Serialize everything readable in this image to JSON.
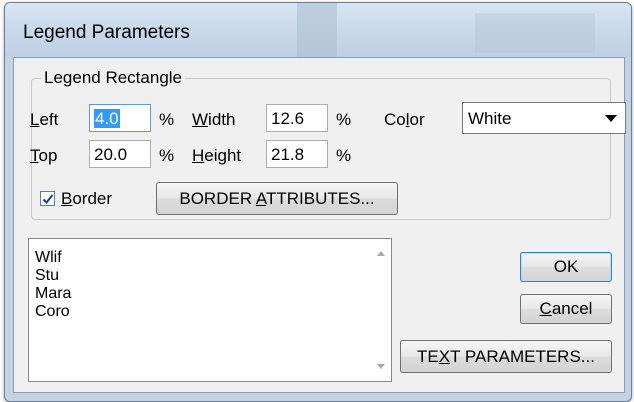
{
  "window": {
    "title": "Legend Parameters"
  },
  "legend_rect": {
    "title": "Legend Rectangle",
    "left": {
      "label_ul": "L",
      "label_rest": "eft",
      "value": "4.0",
      "unit": "%"
    },
    "width": {
      "label_ul": "W",
      "label_rest": "idth",
      "value": "12.6",
      "unit": "%"
    },
    "top": {
      "label_ul": "T",
      "label_rest": "op",
      "value": "20.0",
      "unit": "%"
    },
    "height": {
      "label_ul": "H",
      "label_rest": "eight",
      "value": "21.8",
      "unit": "%"
    },
    "color": {
      "label_pre": "Co",
      "label_ul": "l",
      "label_rest": "or",
      "value": "White"
    },
    "border": {
      "checked": true,
      "label_ul": "B",
      "label_rest": "order"
    },
    "border_attributes": {
      "pre": "BORDER ",
      "ul": "A",
      "rest": "TTRIBUTES..."
    }
  },
  "list": {
    "items": [
      "Wlif",
      "Stu",
      "Mara",
      "Coro"
    ]
  },
  "buttons": {
    "ok": "OK",
    "cancel": {
      "ul": "C",
      "rest": "ancel"
    },
    "text_parameters": {
      "pre": "TE",
      "ul": "X",
      "rest": "T PARAMETERS..."
    }
  }
}
